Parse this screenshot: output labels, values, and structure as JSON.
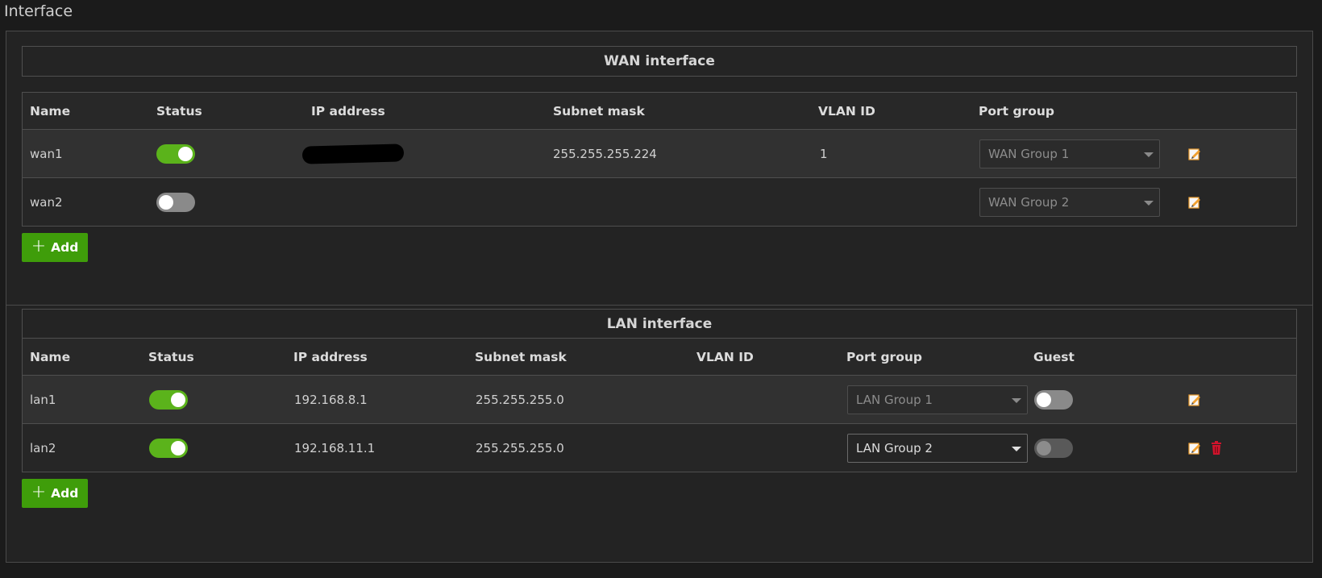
{
  "page": {
    "title": "Interface"
  },
  "wan": {
    "title": "WAN interface",
    "columns": {
      "name": "Name",
      "status": "Status",
      "ip": "IP address",
      "mask": "Subnet mask",
      "vlan": "VLAN ID",
      "port_group": "Port group"
    },
    "rows": [
      {
        "name": "wan1",
        "status": "on",
        "ip": "",
        "mask": "255.255.255.224",
        "vlan": "1",
        "port_group": "WAN Group 1"
      },
      {
        "name": "wan2",
        "status": "off",
        "ip": "",
        "mask": "",
        "vlan": "",
        "port_group": "WAN Group 2"
      }
    ],
    "add_label": "Add"
  },
  "lan": {
    "title": "LAN interface",
    "columns": {
      "name": "Name",
      "status": "Status",
      "ip": "IP address",
      "mask": "Subnet mask",
      "vlan": "VLAN ID",
      "port_group": "Port group",
      "guest": "Guest"
    },
    "rows": [
      {
        "name": "lan1",
        "status": "on",
        "ip": "192.168.8.1",
        "mask": "255.255.255.0",
        "vlan": "",
        "port_group": "LAN Group 1",
        "guest": "off"
      },
      {
        "name": "lan2",
        "status": "on",
        "ip": "192.168.11.1",
        "mask": "255.255.255.0",
        "vlan": "",
        "port_group": "LAN Group 2",
        "guest": "off"
      }
    ],
    "add_label": "Add"
  },
  "icons": {
    "edit": "edit-icon",
    "delete": "trash-icon",
    "add": "plus-icon",
    "dropdown": "chevron-down-icon"
  },
  "colors": {
    "accent": "#3f9d0a",
    "toggle_on": "#5bb31b",
    "delete": "#d0142c",
    "edit": "#f0a030"
  }
}
